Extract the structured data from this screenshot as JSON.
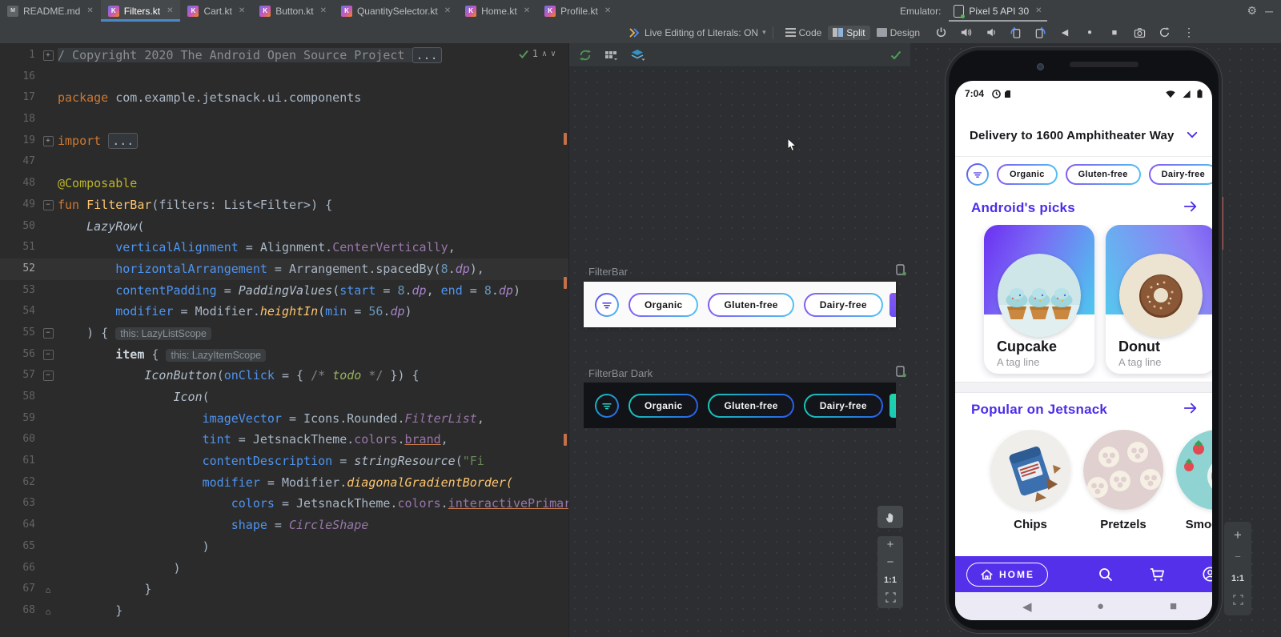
{
  "tabs_bar": {
    "tabs": [
      {
        "label": "README.md",
        "icon": "markdown",
        "active": false
      },
      {
        "label": "Filters.kt",
        "icon": "kotlin",
        "active": true
      },
      {
        "label": "Cart.kt",
        "icon": "kotlin",
        "active": false
      },
      {
        "label": "Button.kt",
        "icon": "kotlin",
        "active": false
      },
      {
        "label": "QuantitySelector.kt",
        "icon": "kotlin",
        "active": false
      },
      {
        "label": "Home.kt",
        "icon": "kotlin",
        "active": false
      },
      {
        "label": "Profile.kt",
        "icon": "kotlin",
        "active": false
      }
    ],
    "emulator_label": "Emulator:",
    "emulator_tab": "Pixel 5 API 30"
  },
  "toolbar": {
    "live_literals": "Live Editing of Literals: ON",
    "modes": [
      {
        "label": "Code",
        "icon": "code-view-icon",
        "active": false
      },
      {
        "label": "Split",
        "icon": "split-view-icon",
        "active": true
      },
      {
        "label": "Design",
        "icon": "design-view-icon",
        "active": false
      }
    ],
    "emulator_controls": [
      "power",
      "volume-up",
      "volume-down",
      "rotate-left",
      "rotate-right",
      "back",
      "home",
      "overview",
      "screenshot",
      "snapshot",
      "more"
    ]
  },
  "editor": {
    "inspection_count": "1",
    "lines": [
      {
        "n": "1",
        "g": "+",
        "seg": [
          [
            "/ Copyright 2020 The Android Open Source Project ",
            "cmtbg"
          ],
          [
            "...",
            "fold"
          ]
        ]
      },
      {
        "n": "16",
        "seg": []
      },
      {
        "n": "17",
        "seg": [
          [
            "package",
            "kw"
          ],
          [
            " com.example.jetsnack.ui.components",
            "p"
          ]
        ]
      },
      {
        "n": "18",
        "seg": []
      },
      {
        "n": "19",
        "g": "+",
        "seg": [
          [
            "import",
            "kw"
          ],
          [
            " ",
            "p"
          ],
          [
            "...",
            "fold"
          ]
        ]
      },
      {
        "n": "47",
        "seg": []
      },
      {
        "n": "48",
        "seg": [
          [
            "@Composable",
            "ann"
          ]
        ]
      },
      {
        "n": "49",
        "g": "-",
        "seg": [
          [
            "fun ",
            "kw"
          ],
          [
            "FilterBar",
            "fn"
          ],
          [
            "(filters: List<Filter>) {",
            "p"
          ]
        ]
      },
      {
        "n": "50",
        "seg": [
          [
            "    ",
            "p"
          ],
          [
            "LazyRow",
            "it"
          ],
          [
            "(",
            "p"
          ]
        ]
      },
      {
        "n": "51",
        "seg": [
          [
            "        ",
            "p"
          ],
          [
            "verticalAlignment",
            "arg"
          ],
          [
            " = Alignment.",
            "p"
          ],
          [
            "CenterVertically",
            "prop"
          ],
          [
            ",",
            "p"
          ]
        ]
      },
      {
        "n": "52",
        "hl": true,
        "seg": [
          [
            "        ",
            "p"
          ],
          [
            "horizontalArrangement",
            "arg"
          ],
          [
            " = Arrangement.spacedBy(",
            "p"
          ],
          [
            "8",
            "num"
          ],
          [
            ".",
            "p"
          ],
          [
            "dp",
            "ext"
          ],
          [
            "),",
            "p"
          ]
        ]
      },
      {
        "n": "53",
        "seg": [
          [
            "        ",
            "p"
          ],
          [
            "contentPadding",
            "arg"
          ],
          [
            " = ",
            "p"
          ],
          [
            "PaddingValues",
            "it"
          ],
          [
            "(",
            "p"
          ],
          [
            "start",
            "arg"
          ],
          [
            " = ",
            "p"
          ],
          [
            "8",
            "num"
          ],
          [
            ".",
            "p"
          ],
          [
            "dp",
            "ext"
          ],
          [
            ", ",
            "p"
          ],
          [
            "end",
            "arg"
          ],
          [
            " = ",
            "p"
          ],
          [
            "8",
            "num"
          ],
          [
            ".",
            "p"
          ],
          [
            "dp",
            "ext"
          ],
          [
            ")",
            "p"
          ]
        ]
      },
      {
        "n": "54",
        "seg": [
          [
            "        ",
            "p"
          ],
          [
            "modifier",
            "arg"
          ],
          [
            " = Modifier.",
            "p"
          ],
          [
            "heightIn",
            "fnit"
          ],
          [
            "(",
            "p"
          ],
          [
            "min",
            "arg"
          ],
          [
            " = ",
            "p"
          ],
          [
            "56",
            "num"
          ],
          [
            ".",
            "p"
          ],
          [
            "dp",
            "ext"
          ],
          [
            ")",
            "p"
          ]
        ]
      },
      {
        "n": "55",
        "g": "-",
        "seg": [
          [
            "    ) { ",
            "p"
          ],
          [
            "this: LazyListScope",
            "hint"
          ]
        ]
      },
      {
        "n": "56",
        "g": "-",
        "seg": [
          [
            "        ",
            "p"
          ],
          [
            "item",
            "bold"
          ],
          [
            " { ",
            "p"
          ],
          [
            "this: LazyItemScope",
            "hint"
          ]
        ]
      },
      {
        "n": "57",
        "g": "-",
        "seg": [
          [
            "            ",
            "p"
          ],
          [
            "IconButton",
            "it"
          ],
          [
            "(",
            "p"
          ],
          [
            "onClick",
            "arg"
          ],
          [
            " = { ",
            "p"
          ],
          [
            "/* ",
            "cmt"
          ],
          [
            "todo",
            "todo"
          ],
          [
            " */",
            "cmt"
          ],
          [
            " }) {",
            "p"
          ]
        ]
      },
      {
        "n": "58",
        "seg": [
          [
            "                ",
            "p"
          ],
          [
            "Icon",
            "it"
          ],
          [
            "(",
            "p"
          ]
        ]
      },
      {
        "n": "59",
        "seg": [
          [
            "                    ",
            "p"
          ],
          [
            "imageVector",
            "arg"
          ],
          [
            " = Icons.Rounded.",
            "p"
          ],
          [
            "FilterList",
            "propi"
          ],
          [
            ",",
            "p"
          ]
        ]
      },
      {
        "n": "60",
        "seg": [
          [
            "                    ",
            "p"
          ],
          [
            "tint",
            "arg"
          ],
          [
            " = JetsnackTheme.",
            "p"
          ],
          [
            "colors",
            "prop"
          ],
          [
            ".",
            "p"
          ],
          [
            "brand",
            "propu"
          ],
          [
            ",",
            "p"
          ]
        ]
      },
      {
        "n": "61",
        "seg": [
          [
            "                    ",
            "p"
          ],
          [
            "contentDescription",
            "arg"
          ],
          [
            " = ",
            "p"
          ],
          [
            "stringResource",
            "it"
          ],
          [
            "(",
            "p"
          ],
          [
            "\"Fi",
            "str"
          ]
        ]
      },
      {
        "n": "62",
        "seg": [
          [
            "                    ",
            "p"
          ],
          [
            "modifier",
            "arg"
          ],
          [
            " = Modifier.",
            "p"
          ],
          [
            "diagonalGradientBorder(",
            "fnit"
          ]
        ]
      },
      {
        "n": "63",
        "seg": [
          [
            "                        ",
            "p"
          ],
          [
            "colors",
            "arg"
          ],
          [
            " = JetsnackTheme.",
            "p"
          ],
          [
            "colors",
            "prop"
          ],
          [
            ".",
            "p"
          ],
          [
            "interactivePrimary",
            "propu"
          ]
        ]
      },
      {
        "n": "64",
        "seg": [
          [
            "                        ",
            "p"
          ],
          [
            "shape",
            "arg"
          ],
          [
            " = ",
            "p"
          ],
          [
            "CircleShape",
            "propi"
          ]
        ]
      },
      {
        "n": "65",
        "seg": [
          [
            "                    )",
            "p"
          ]
        ]
      },
      {
        "n": "66",
        "seg": [
          [
            "                )",
            "p"
          ]
        ]
      },
      {
        "n": "67",
        "g": "^",
        "seg": [
          [
            "            }",
            "p"
          ]
        ]
      },
      {
        "n": "68",
        "g": "^",
        "seg": [
          [
            "        }",
            "p"
          ]
        ]
      }
    ]
  },
  "preview": {
    "light": {
      "title": "FilterBar",
      "chips": [
        "Organic",
        "Gluten-free",
        "Dairy-free"
      ]
    },
    "dark": {
      "title": "FilterBar Dark",
      "chips": [
        "Organic",
        "Gluten-free",
        "Dairy-free"
      ]
    },
    "zoom_label": "1:1",
    "icons": [
      "build-refresh-icon",
      "layout-grid-icon",
      "layers-icon",
      "render-success-check-icon",
      "pan-hand-icon",
      "zoom-in-icon",
      "zoom-out-icon",
      "zoom-fit-icon"
    ]
  },
  "phone": {
    "time": "7:04",
    "delivery": "Delivery to 1600 Amphitheater Way",
    "chips": [
      "Organic",
      "Gluten-free",
      "Dairy-free"
    ],
    "sections": [
      {
        "title": "Android's picks"
      },
      {
        "title": "Popular on Jetsnack"
      }
    ],
    "cards": [
      {
        "name": "Cupcake",
        "tag": "A tag line"
      },
      {
        "name": "Donut",
        "tag": "A tag line"
      }
    ],
    "popular": [
      "Chips",
      "Pretzels",
      "Smoothies"
    ],
    "nav": {
      "home": "HOME",
      "icons": [
        "home-icon",
        "search-icon",
        "cart-icon",
        "profile-icon"
      ]
    },
    "android_nav": [
      "back",
      "home",
      "overview"
    ]
  },
  "emulator": {
    "zoom_label": "1:1"
  },
  "colors": {
    "accent_indigo": "#4c2ee8",
    "nav_purple": "#5430eb",
    "ide_tab_underline": "#4a88c7",
    "chip_gradient_light": [
      "#8559f2",
      "#4fc4f0"
    ],
    "chip_gradient_dark": [
      "#17c9b4",
      "#2b5cf0"
    ],
    "error_stripe": "#c75450"
  }
}
